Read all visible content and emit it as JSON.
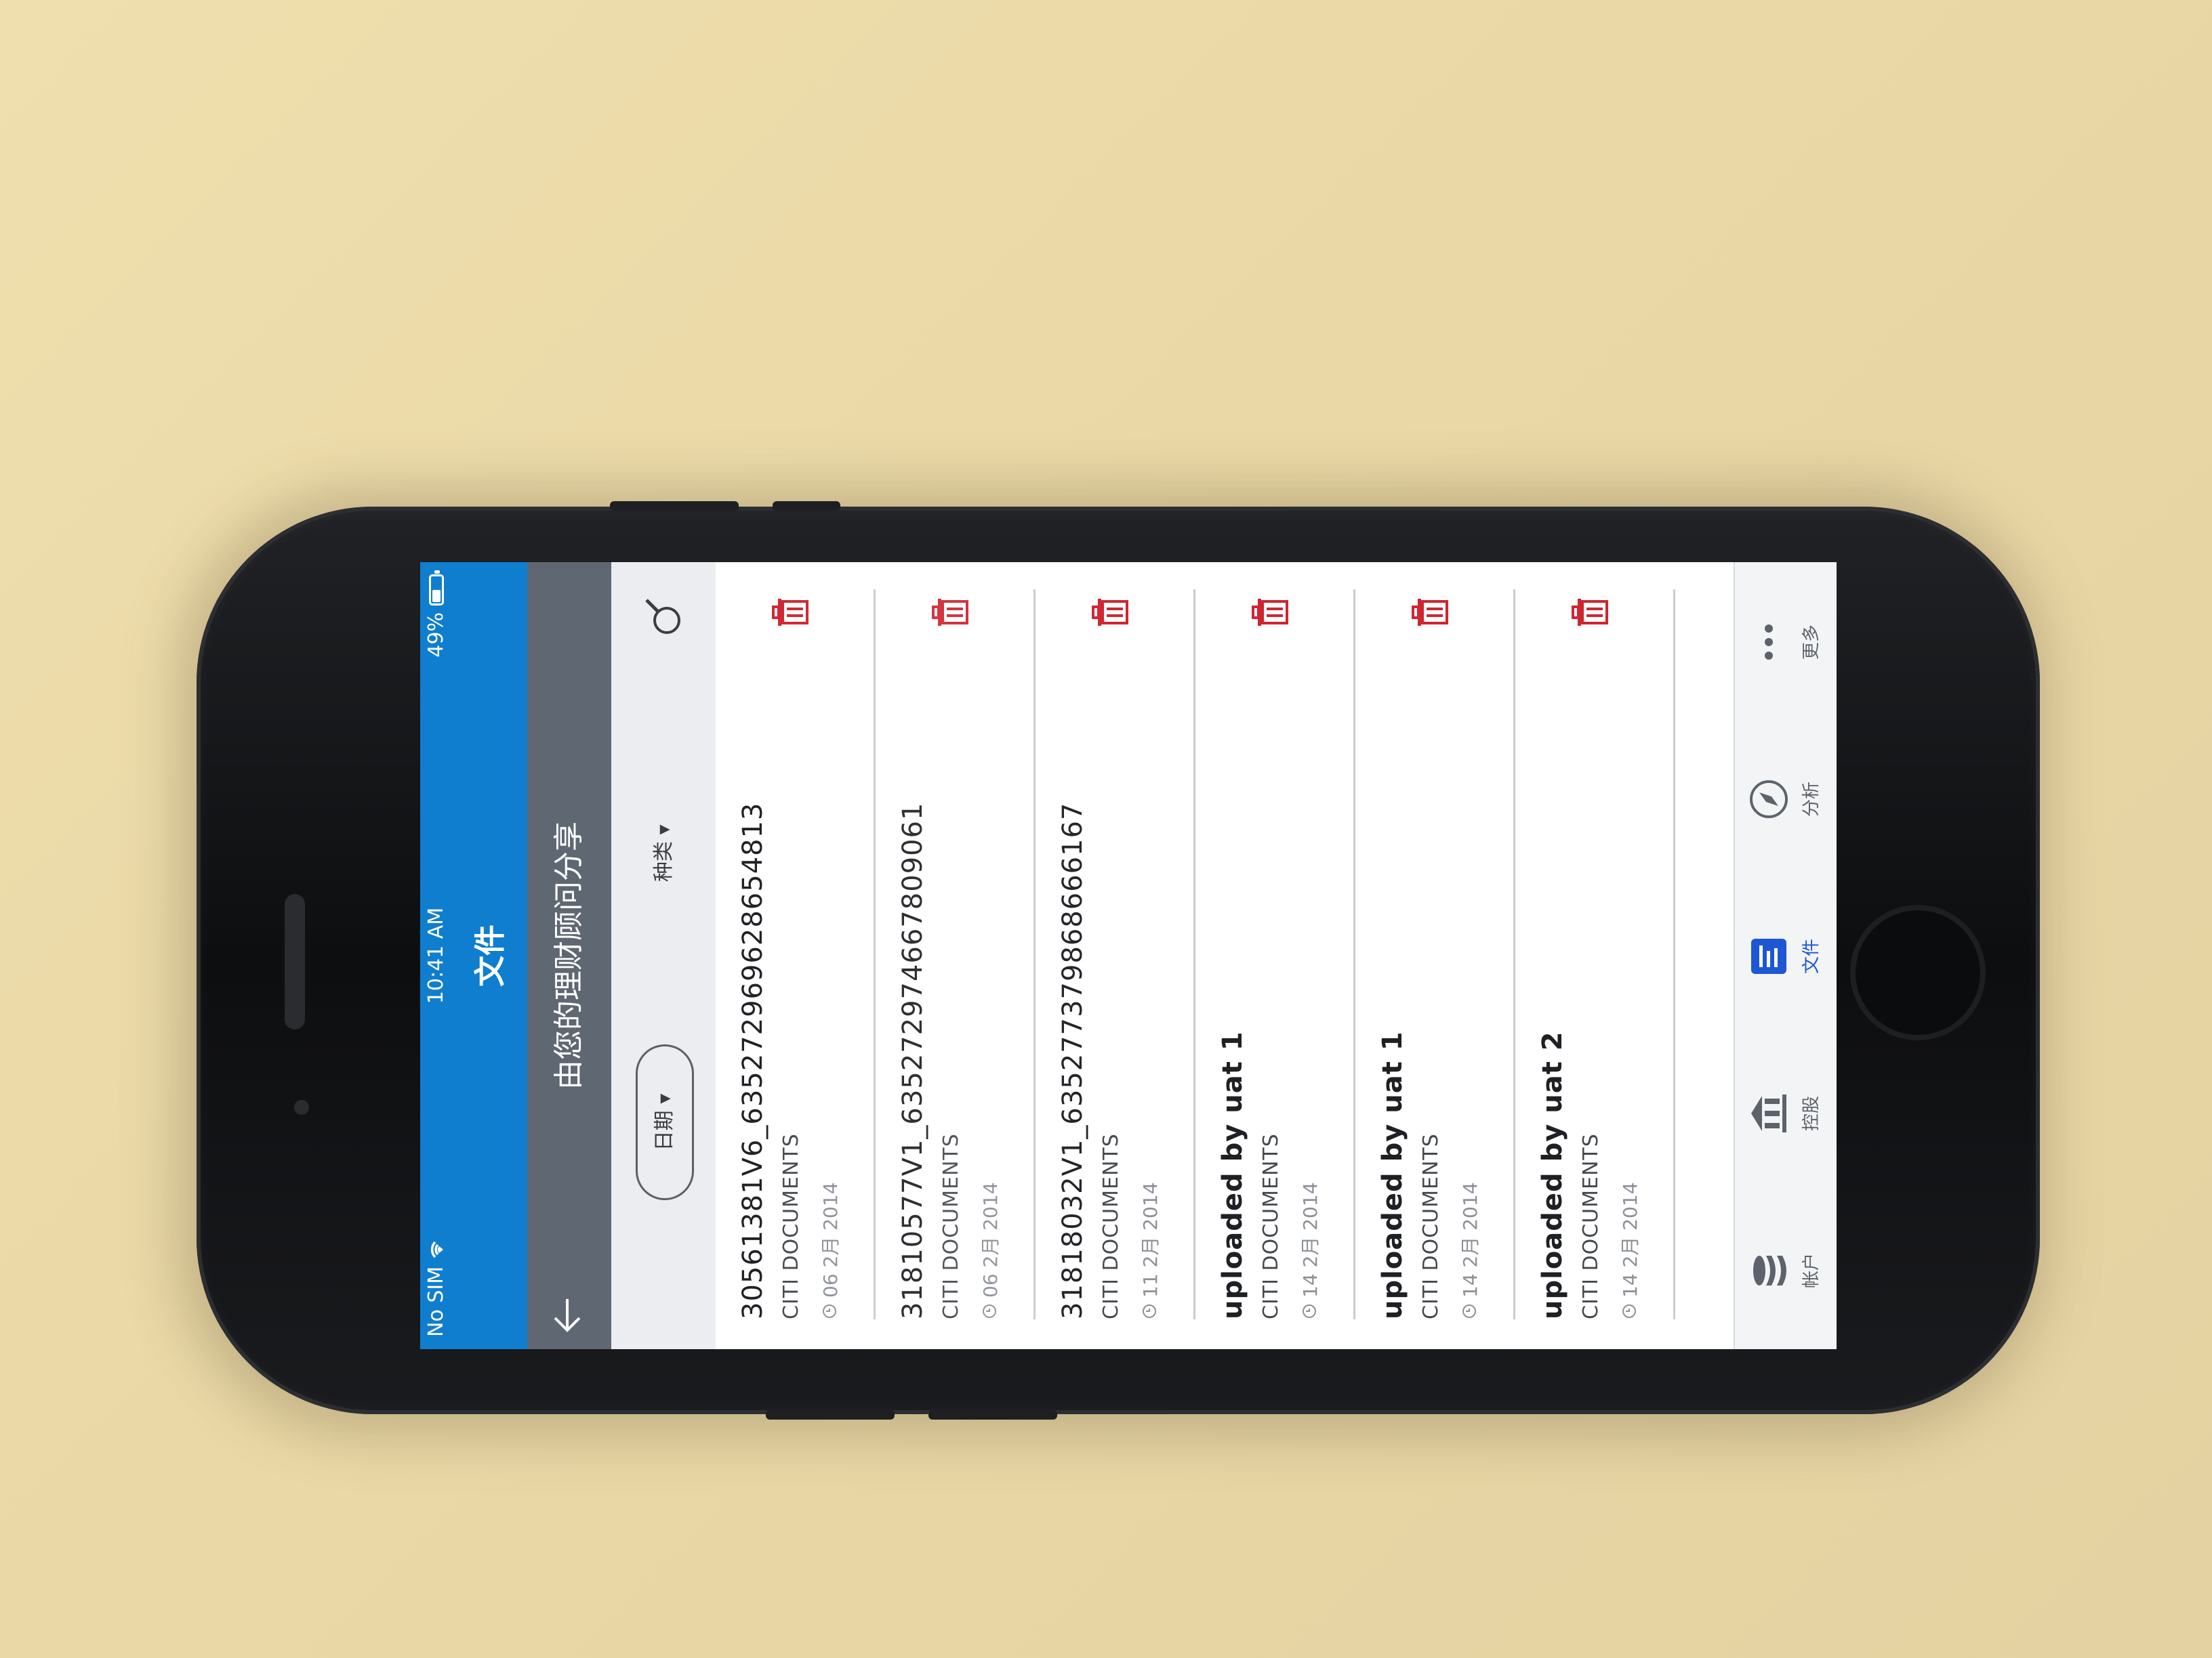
{
  "status_bar": {
    "carrier": "No SIM",
    "time": "10:41 AM",
    "battery": "49%",
    "battery_level": 0.49
  },
  "header": {
    "title": "文件",
    "subtitle": "由您的理财顾问分享",
    "back_icon": "arrow-left-icon"
  },
  "filters": {
    "date_label": "日期 ▾",
    "type_label": "种类 ▾",
    "search_icon": "search-icon"
  },
  "documents": [
    {
      "name": "30561381V6_635272969628654813",
      "source": "CITI DOCUMENTS",
      "date": "06 2月 2014",
      "bold": false
    },
    {
      "name": "31810577V1_635272974667809061",
      "source": "CITI DOCUMENTS",
      "date": "06 2月 2014",
      "bold": false
    },
    {
      "name": "31818032V1_635277379868666167",
      "source": "CITI DOCUMENTS",
      "date": "11 2月 2014",
      "bold": false
    },
    {
      "name": "uploaded by uat 1",
      "source": "CITI DOCUMENTS",
      "date": "14 2月 2014",
      "bold": true
    },
    {
      "name": "uploaded by uat 1",
      "source": "CITI DOCUMENTS",
      "date": "14 2月 2014",
      "bold": true
    },
    {
      "name": "uploaded by uat 2",
      "source": "CITI DOCUMENTS",
      "date": "14 2月 2014",
      "bold": true
    }
  ],
  "tabs": [
    {
      "label": "帐户",
      "icon": "coins-stack-icon",
      "active": false
    },
    {
      "label": "控股",
      "icon": "bank-building-icon",
      "active": false
    },
    {
      "label": "文件",
      "icon": "document-list-icon",
      "active": true
    },
    {
      "label": "分析",
      "icon": "compass-icon",
      "active": false
    },
    {
      "label": "更多",
      "icon": "more-dots-icon",
      "active": false
    }
  ],
  "colors": {
    "brand_blue": "#0f7ecf",
    "subheader_gray": "#5f6772",
    "trash_red": "#d0252f",
    "active_tab": "#1d57d4"
  }
}
